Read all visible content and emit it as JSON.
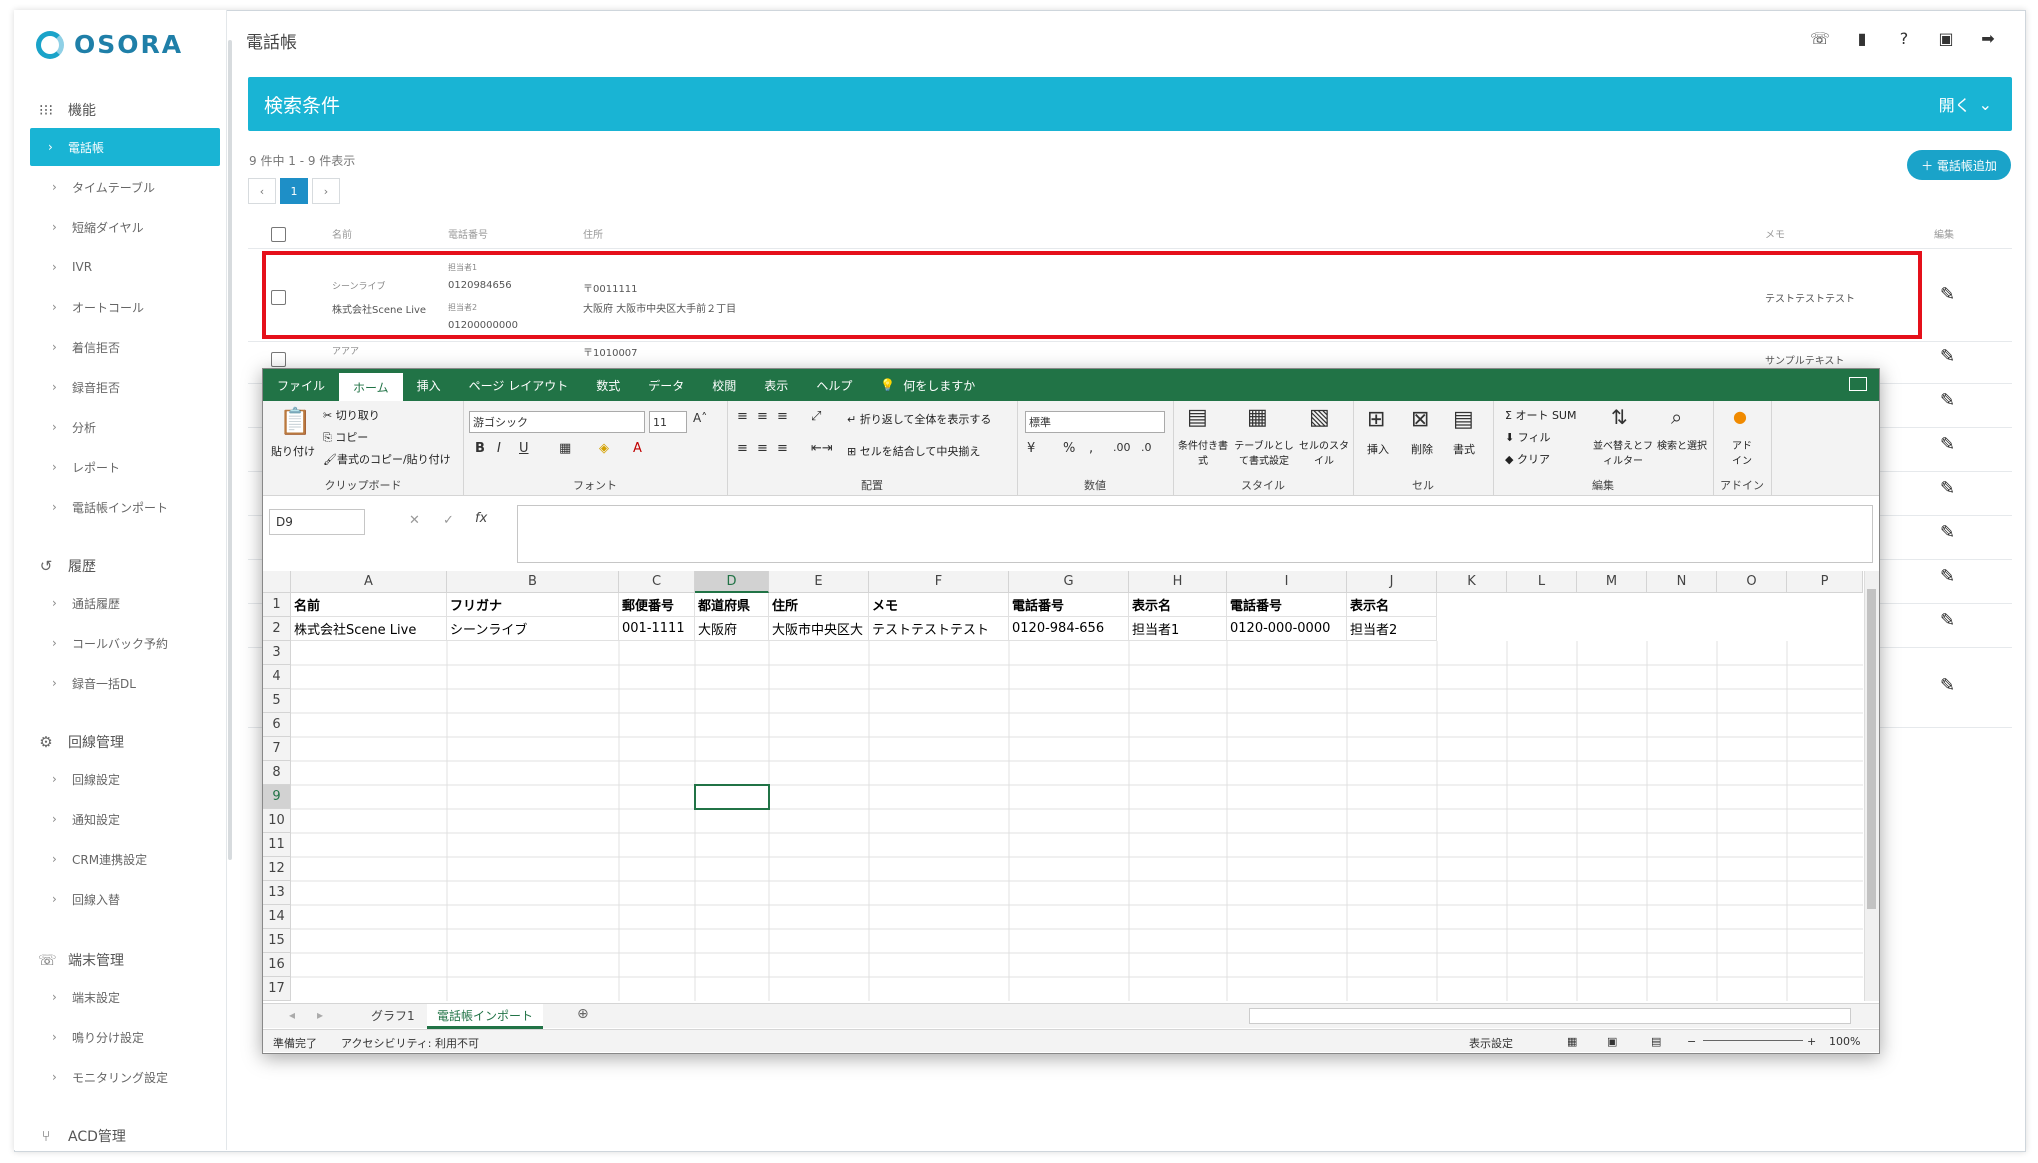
{
  "app": {
    "logo": "OSORA",
    "page_title": "電話帳"
  },
  "sidebar": {
    "sections": [
      {
        "icon": "grid-icon",
        "label": "機能"
      },
      {
        "icon": "history-icon",
        "label": "履歴"
      },
      {
        "icon": "gear-icon",
        "label": "回線管理"
      },
      {
        "icon": "phone-icon",
        "label": "端末管理"
      },
      {
        "icon": "acd-icon",
        "label": "ACD管理"
      }
    ],
    "items": [
      {
        "label": "電話帳",
        "active": true
      },
      {
        "label": "タイムテーブル"
      },
      {
        "label": "短縮ダイヤル"
      },
      {
        "label": "IVR"
      },
      {
        "label": "オートコール"
      },
      {
        "label": "着信拒否"
      },
      {
        "label": "録音拒否"
      },
      {
        "label": "分析"
      },
      {
        "label": "レポート"
      },
      {
        "label": "電話帳インポート"
      },
      {
        "label": "通話履歴"
      },
      {
        "label": "コールバック予約"
      },
      {
        "label": "録音一括DL"
      },
      {
        "label": "回線設定"
      },
      {
        "label": "通知設定"
      },
      {
        "label": "CRM連携設定"
      },
      {
        "label": "回線入替"
      },
      {
        "label": "端末設定"
      },
      {
        "label": "鳴り分け設定"
      },
      {
        "label": "モニタリング設定"
      }
    ]
  },
  "header_icons": [
    "phone-icon",
    "book-icon",
    "help-icon",
    "account-icon",
    "logout-icon"
  ],
  "search": {
    "title": "検索条件",
    "toggle_label": "開く"
  },
  "list": {
    "count_text": "9 件中 1 - 9 件表示",
    "pager": {
      "prev": "‹",
      "current": "1",
      "next": "›"
    },
    "add_button": "＋ 電話帳追加",
    "headers": {
      "name": "名前",
      "phone": "電話番号",
      "address": "住所",
      "memo": "メモ",
      "edit": "編集"
    },
    "rows": [
      {
        "kana": "シーンライブ",
        "name": "株式会社Scene Live",
        "contact1_label": "担当者1",
        "contact1_phone": "0120984656",
        "contact2_label": "担当者2",
        "contact2_phone": "01200000000",
        "zip": "〒0011111",
        "address": "大阪府 大阪市中央区大手前２丁目",
        "memo": "テストテストテスト"
      },
      {
        "kana": "アアア",
        "zip": "〒1010007",
        "memo": "サンプルテキスト"
      }
    ]
  },
  "excel": {
    "tabs": [
      "ファイル",
      "ホーム",
      "挿入",
      "ページ レイアウト",
      "数式",
      "データ",
      "校閲",
      "表示",
      "ヘルプ",
      "何をしますか"
    ],
    "active_tab": "ホーム",
    "ribbon": {
      "clipboard": {
        "paste": "貼り付け",
        "cut": "切り取り",
        "copy": "コピー",
        "format_painter": "書式のコピー/貼り付け",
        "label": "クリップボード"
      },
      "font": {
        "name": "游ゴシック",
        "size": "11",
        "label": "フォント"
      },
      "alignment": {
        "wrap": "折り返して全体を表示する",
        "merge": "セルを結合して中央揃え",
        "label": "配置"
      },
      "number": {
        "format": "標準",
        "label": "数値"
      },
      "styles": {
        "conditional": "条件付き書式",
        "table": "テーブルとして書式設定",
        "cell": "セルのスタイル",
        "label": "スタイル"
      },
      "cells": {
        "insert": "挿入",
        "delete": "削除",
        "format": "書式",
        "label": "セル"
      },
      "editing": {
        "autosum": "オート SUM",
        "fill": "フィル",
        "clear": "クリア",
        "sort": "並べ替えとフィルター",
        "find": "検索と選択",
        "label": "編集"
      },
      "addins": {
        "addin": "アド イン",
        "label": "アドイン"
      }
    },
    "name_box": "D9",
    "fx": "fx",
    "columns": [
      "A",
      "B",
      "C",
      "D",
      "E",
      "F",
      "G",
      "H",
      "I",
      "J",
      "K",
      "L",
      "M",
      "N",
      "O",
      "P"
    ],
    "row_numbers": [
      "1",
      "2",
      "3",
      "4",
      "5",
      "6",
      "7",
      "8",
      "9",
      "10",
      "11",
      "12",
      "13",
      "14",
      "15",
      "16",
      "17"
    ],
    "header_row": [
      "名前",
      "フリガナ",
      "郵便番号",
      "都道府県",
      "住所",
      "メモ",
      "電話番号",
      "表示名",
      "電話番号",
      "表示名"
    ],
    "data_row": [
      "株式会社Scene Live",
      "シーンライブ",
      "001-1111",
      "大阪府",
      "大阪市中央区大",
      "テストテストテスト",
      "0120-984-656",
      "担当者1",
      "0120-000-0000",
      "担当者2"
    ],
    "sheets": [
      "グラフ1",
      "電話帳インポート"
    ],
    "active_sheet": "電話帳インポート",
    "status": {
      "ready": "準備完了",
      "accessibility": "アクセシビリティ: 利用不可",
      "display_settings": "表示設定",
      "zoom": "100%"
    },
    "accent": "#217346"
  },
  "colors": {
    "brand": "#19b4d4",
    "highlight": "#e5101a"
  }
}
